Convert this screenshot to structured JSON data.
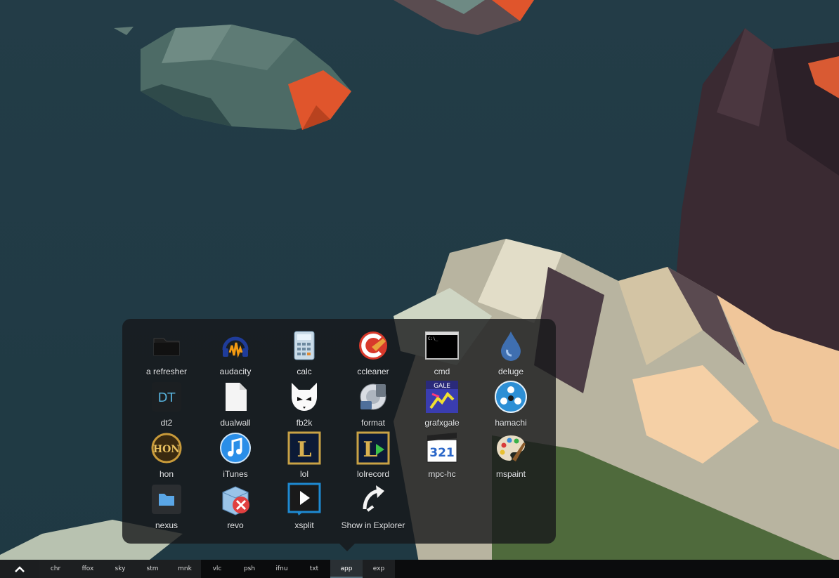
{
  "popup": {
    "apps": [
      {
        "label": "a refresher",
        "icon": "folder-icon"
      },
      {
        "label": "audacity",
        "icon": "audacity-icon"
      },
      {
        "label": "calc",
        "icon": "calculator-icon"
      },
      {
        "label": "ccleaner",
        "icon": "ccleaner-icon"
      },
      {
        "label": "cmd",
        "icon": "terminal-icon"
      },
      {
        "label": "deluge",
        "icon": "deluge-icon"
      },
      {
        "label": "dt2",
        "icon": "dt2-icon"
      },
      {
        "label": "dualwall",
        "icon": "document-icon"
      },
      {
        "label": "fb2k",
        "icon": "foobar-icon"
      },
      {
        "label": "format",
        "icon": "format-icon"
      },
      {
        "label": "grafxgale",
        "icon": "grafxgale-icon"
      },
      {
        "label": "hamachi",
        "icon": "hamachi-icon"
      },
      {
        "label": "hon",
        "icon": "hon-icon"
      },
      {
        "label": "iTunes",
        "icon": "itunes-icon"
      },
      {
        "label": "lol",
        "icon": "lol-icon"
      },
      {
        "label": "lolrecord",
        "icon": "lolrecord-icon"
      },
      {
        "label": "mpc-hc",
        "icon": "mpc-hc-icon"
      },
      {
        "label": "mspaint",
        "icon": "mspaint-icon"
      },
      {
        "label": "nexus",
        "icon": "nexus-folder-icon"
      },
      {
        "label": "revo",
        "icon": "revo-icon"
      },
      {
        "label": "xsplit",
        "icon": "xsplit-icon"
      },
      {
        "label": "Show in Explorer",
        "icon": "show-in-explorer-icon"
      }
    ],
    "icon_text": {
      "dt2": "DT",
      "grafxgale": "GALE",
      "hon": "HON",
      "lol": "L",
      "mpc": "321"
    }
  },
  "taskbar": {
    "start_icon": "chevron-up-icon",
    "items": [
      {
        "label": "chr"
      },
      {
        "label": "ffox"
      },
      {
        "label": "sky"
      },
      {
        "label": "stm"
      },
      {
        "label": "mnk"
      },
      {
        "label": "vlc"
      },
      {
        "label": "psh"
      },
      {
        "label": "ifnu"
      },
      {
        "label": "txt"
      },
      {
        "label": "app"
      },
      {
        "label": "exp"
      }
    ],
    "active_item": "app"
  },
  "colors": {
    "sky": "#233d48",
    "accent_orange": "#e0552c",
    "taskbar_bg": "#0b0c0d"
  }
}
